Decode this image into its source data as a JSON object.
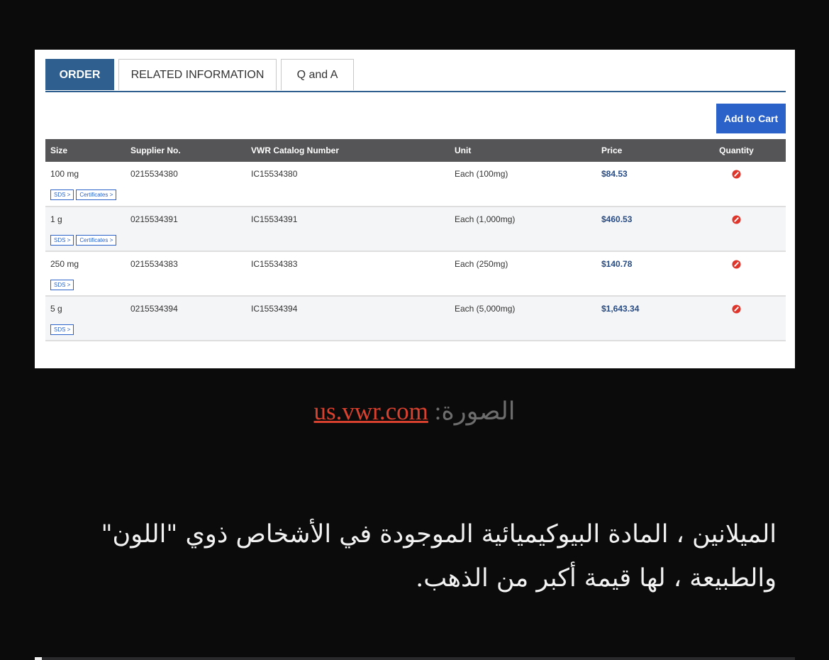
{
  "tabs": [
    {
      "label": "ORDER"
    },
    {
      "label": "RELATED INFORMATION"
    },
    {
      "label": "Q and A"
    }
  ],
  "cart_button": "Add to Cart",
  "table": {
    "headers": [
      "Size",
      "Supplier No.",
      "VWR Catalog Number",
      "Unit",
      "Price",
      "Quantity"
    ],
    "rows": [
      {
        "size": "100 mg",
        "supplier_no": "0215534380",
        "catalog": "IC15534380",
        "unit": "Each (100mg)",
        "price": "$84.53",
        "links": [
          "SDS >",
          "Certificates >"
        ]
      },
      {
        "size": "1 g",
        "supplier_no": "0215534391",
        "catalog": "IC15534391",
        "unit": "Each (1,000mg)",
        "price": "$460.53",
        "links": [
          "SDS >",
          "Certificates >"
        ]
      },
      {
        "size": "250 mg",
        "supplier_no": "0215534383",
        "catalog": "IC15534383",
        "unit": "Each (250mg)",
        "price": "$140.78",
        "links": [
          "SDS >"
        ]
      },
      {
        "size": "5 g",
        "supplier_no": "0215534394",
        "catalog": "IC15534394",
        "unit": "Each (5,000mg)",
        "price": "$1,643.34",
        "links": [
          "SDS >"
        ]
      }
    ],
    "quantity_icon": "not-available-icon",
    "quantity_icon_color": "#e0352b"
  },
  "caption": {
    "prefix": "الصورة: ",
    "link": "us.vwr.com"
  },
  "body_text": "الميلانين ، المادة البيوكيميائية الموجودة في الأشخاص ذوي \"اللون\" والطبيعة ، لها قيمة أكبر من الذهب.",
  "colors": {
    "page_bg": "#0b0b0c",
    "tab_active": "#2f5f8f",
    "button": "#2a62c9",
    "header_bg": "#555557",
    "price": "#274c86",
    "caption_link": "#d9412f"
  }
}
